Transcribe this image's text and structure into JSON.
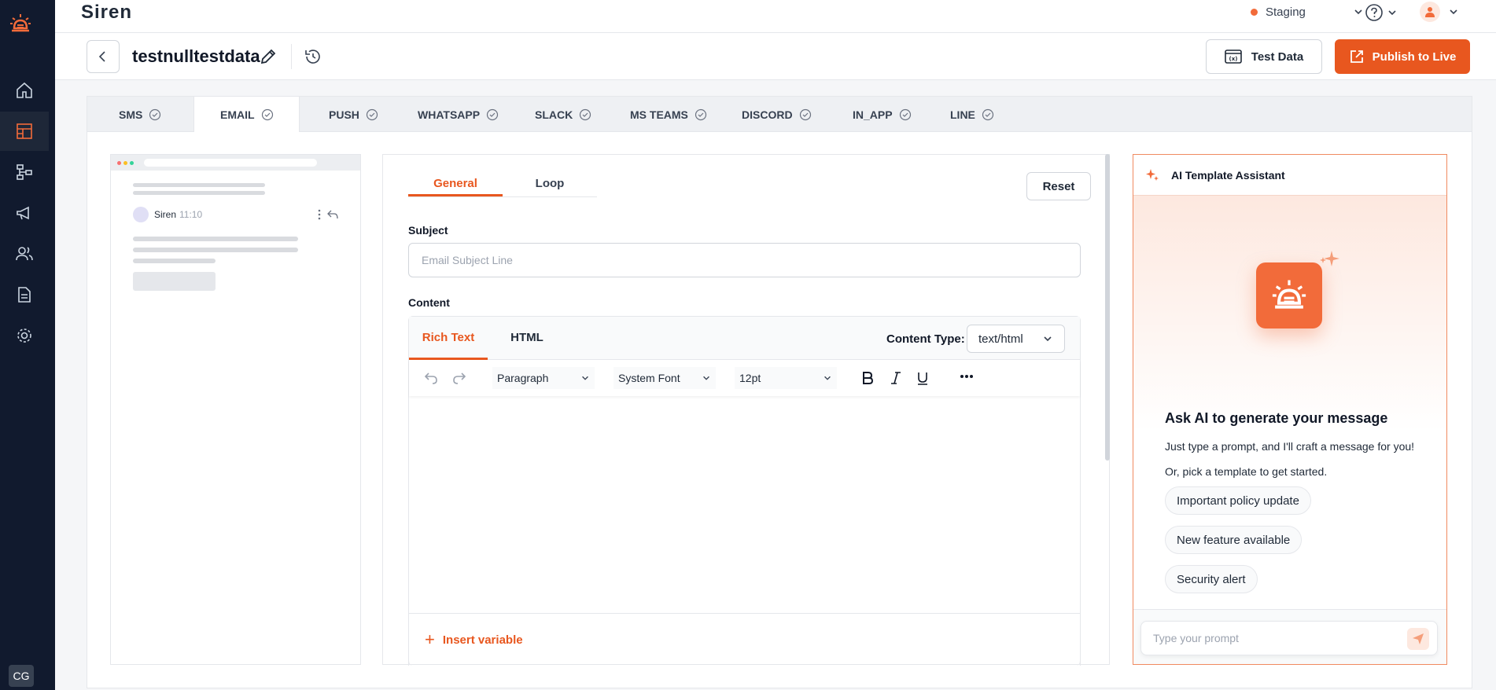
{
  "sidebar": {
    "items": [
      {
        "name": "home"
      },
      {
        "name": "templates",
        "active": true
      },
      {
        "name": "workflows"
      },
      {
        "name": "campaigns"
      },
      {
        "name": "users"
      },
      {
        "name": "logs"
      },
      {
        "name": "settings"
      }
    ],
    "avatar_initials": "CG"
  },
  "topbar": {
    "brand": "Siren",
    "environment": "Staging",
    "env_color": "#f26b3a"
  },
  "subbar": {
    "template_name": "testnulltestdata",
    "test_data_label": "Test Data",
    "publish_label": "Publish to Live"
  },
  "channels": {
    "tabs": [
      {
        "label": "SMS",
        "active": false
      },
      {
        "label": "EMAIL",
        "active": true
      },
      {
        "label": "PUSH",
        "active": false
      },
      {
        "label": "WHATSAPP",
        "active": false
      },
      {
        "label": "SLACK",
        "active": false
      },
      {
        "label": "MS TEAMS",
        "active": false
      },
      {
        "label": "DISCORD",
        "active": false
      },
      {
        "label": "IN_APP",
        "active": false
      },
      {
        "label": "LINE",
        "active": false
      }
    ]
  },
  "preview": {
    "sender": "Siren",
    "time": "11:10"
  },
  "editor": {
    "tabs": [
      "General",
      "Loop"
    ],
    "active_tab": "General",
    "reset_label": "Reset",
    "subject_label": "Subject",
    "subject_placeholder": "Email Subject Line",
    "content_label": "Content",
    "content_tabs": [
      "Rich Text",
      "HTML"
    ],
    "content_type_label": "Content Type:",
    "content_type_value": "text/html",
    "format_block": "Paragraph",
    "font_family": "System Font",
    "font_size": "12pt",
    "insert_variable_label": "Insert variable"
  },
  "ai": {
    "title": "AI Template Assistant",
    "heading": "Ask AI to generate your message",
    "line1": "Just type a prompt, and I'll craft a message for you!",
    "line2": "Or, pick a template to get started.",
    "chips": [
      "Important policy update",
      "New feature available",
      "Security alert"
    ],
    "prompt_placeholder": "Type your prompt"
  },
  "colors": {
    "accent": "#e8571f",
    "sidebar_bg": "#111a2e"
  }
}
